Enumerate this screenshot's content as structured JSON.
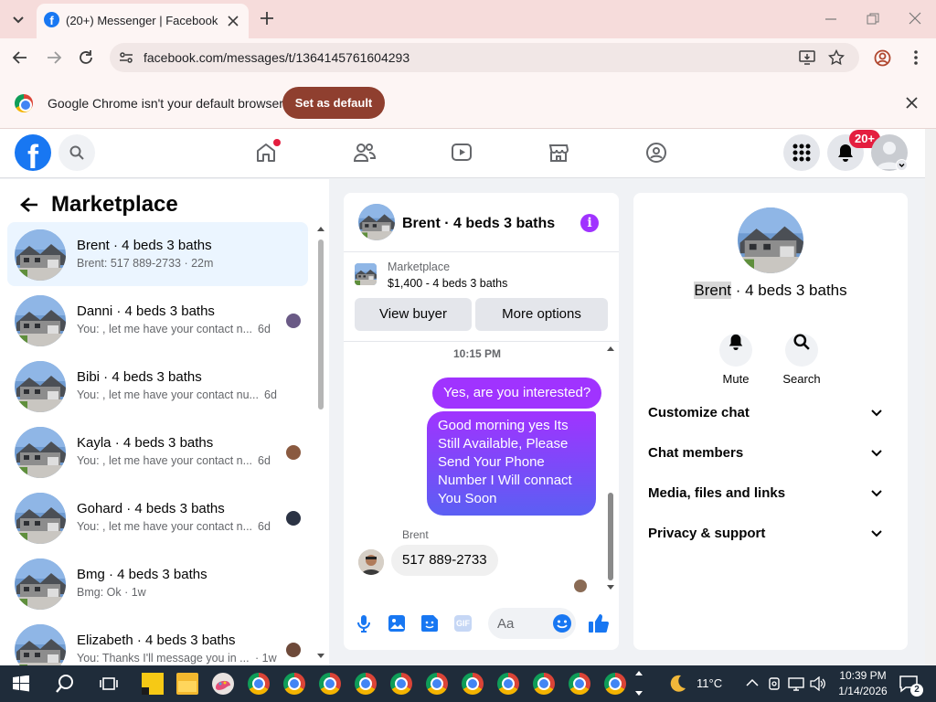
{
  "browser": {
    "tab_title": "(20+) Messenger | Facebook",
    "url": "facebook.com/messages/t/1364145761604293",
    "infobar_text": "Google Chrome isn't your default browser",
    "set_default_label": "Set as default"
  },
  "fb": {
    "notif_badge": "20+",
    "brand_color": "#1877f2"
  },
  "marketplace": {
    "title": "Marketplace",
    "conversations": [
      {
        "name": "Brent · 4 beds 3 baths",
        "preview": "Brent: 517 889-2733 · 22m",
        "time": "",
        "selected": true
      },
      {
        "name": "Danni · 4 beds 3 baths",
        "preview": "You: , let me have your contact n...",
        "time": "6d"
      },
      {
        "name": "Bibi · 4 beds 3 baths",
        "preview": "You: , let me have your contact nu...",
        "time": "6d"
      },
      {
        "name": "Kayla · 4 beds 3 baths",
        "preview": "You: , let me have your contact n...",
        "time": "6d"
      },
      {
        "name": "Gohard · 4 beds 3 baths",
        "preview": "You: , let me have your contact n...",
        "time": "6d"
      },
      {
        "name": "Bmg · 4 beds 3 baths",
        "preview": "Bmg: Ok · 1w",
        "time": ""
      },
      {
        "name": "Elizabeth · 4 beds 3 baths",
        "preview": "You: Thanks I'll message you in ...",
        "time": "· 1w"
      }
    ]
  },
  "chat": {
    "title": "Brent · 4 beds 3 baths",
    "listing_label": "Marketplace",
    "listing_price": "$1,400 - 4 beds 3 baths",
    "view_buyer": "View buyer",
    "more_options": "More options",
    "timestamp": "10:15 PM",
    "msg_out_1": "Yes, are you interested?",
    "msg_out_2_lines": [
      "Good morning yes Its",
      "Still Available, Please",
      "Send Your Phone",
      "Number I Will connact",
      "You Soon"
    ],
    "sender_name": "Brent",
    "msg_in_1": "517 889-2733",
    "composer_placeholder": "Aa"
  },
  "details": {
    "name_highlight": "Brent",
    "name_rest": " · 4 beds 3 baths",
    "mute_label": "Mute",
    "search_label": "Search",
    "sections": [
      "Customize chat",
      "Chat members",
      "Media, files and links",
      "Privacy & support"
    ]
  },
  "taskbar": {
    "weather": "11°C",
    "time": "10:39 PM",
    "date": "1/14/2026",
    "notif_count": "2"
  }
}
